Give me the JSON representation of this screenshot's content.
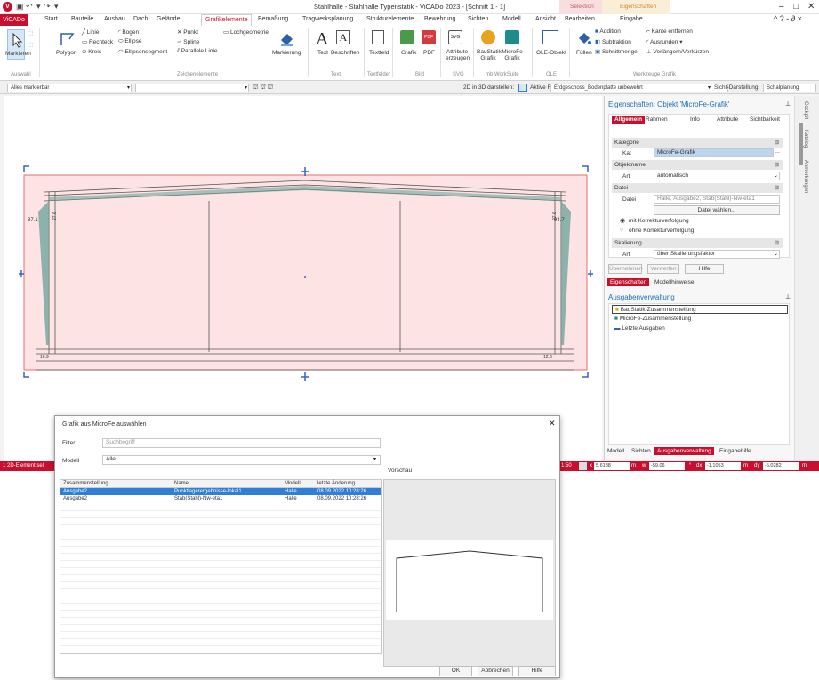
{
  "app": {
    "title": "Stahlhalle - Stahlhalle Typenstatik - ViCADo 2023 - [Schnitt 1 - 1]",
    "context_selection": "Selektion",
    "context_properties": "Eigenschaften",
    "window_controls": [
      "–",
      "□",
      "✕"
    ],
    "ribbon_right_controls": "^ ? - ∂ ×"
  },
  "tabs": [
    "ViCADo",
    "Start",
    "Bauteile",
    "Ausbau",
    "Dach",
    "Gelände",
    "Grafikelemente",
    "Bemaßung",
    "Tragwerksplanung",
    "Strukturelemente",
    "Bewehrung",
    "Sichten",
    "Modell",
    "Ansicht",
    "Bearbeiten",
    "Eingabe"
  ],
  "ribbon": {
    "markieren": "Markieren",
    "auswahl_group": "Auswahl",
    "polygon": "Polygon",
    "linie": "Linie",
    "rechteck": "Rechteck",
    "kreis": "Kreis",
    "bogen": "Bogen",
    "ellipse": "Ellipse",
    "ellipsensegment": "Ellipsensegment",
    "punkt": "Punkt",
    "spline": "Spline",
    "parallele_linie": "Parallele Linie",
    "lochgeometrie": "Lochgeometrie",
    "markierung": "Markierung",
    "zeichenelemente_group": "Zeichenelemente",
    "text": "Text",
    "beschriften": "Beschriften",
    "text_group": "Text",
    "textfeld": "Textfeld",
    "textfelder_group": "Textfelder",
    "grafik": "Grafik",
    "pdf": "PDF",
    "bild_group": "Bild",
    "attribute_erzeugen": "Attribute erzeugen",
    "svg_group": "SVG",
    "baustatik_grafik": "BauStatik Grafik",
    "microfe_grafik": "MicroFe Grafik",
    "workssuite_group": "mb WorkSuite",
    "ole_objekt": "OLE-Objekt",
    "ole_group": "OLE",
    "fuellen": "Füllen",
    "addition": "Addition",
    "subtraktion": "Subtraktion",
    "schnittmenge": "Schnittmenge",
    "kante_entfernen": "Kante entfernen",
    "ausrunden": "Ausrunden",
    "verlaengern": "Verlängern/Verkürzen",
    "werkzeuge_group": "Werkzeuge Grafik"
  },
  "toolbar2": {
    "filter_combo": "Alles markierbar",
    "second_combo": "",
    "show_3d": "2D in 3D darstellen:",
    "active_layer_label": "Aktive Folie:",
    "active_layer": "Erdgeschoss_Bodenplatte unbewehrt",
    "view_display": "Sicht-Darstellung:",
    "view_display_value": "Schalplanung"
  },
  "drawing": {
    "labels": [
      "87.1",
      "94.7",
      "16.9",
      "12.6",
      "27.6",
      "27.6"
    ]
  },
  "properties": {
    "header": "Eigenschaften: Objekt 'MicroFe-Grafik'",
    "tabs": [
      "Allgemein",
      "Rahmen",
      "Info",
      "Attribute",
      "Sichtbarkeit"
    ],
    "section_kategorie": "Kategorie",
    "kat_label": "Kat",
    "kat_value": "MicroFe-Grafik",
    "section_objektname": "Objektname",
    "art_label": "Art",
    "art_value": "automatisch",
    "section_datei": "Datei",
    "datei_label": "Datei",
    "datei_value": "Halle, Ausgabe2, Stab(Stahl)-Nw-eta1",
    "datei_button": "Datei wählen...",
    "radio_mit": "mit Korrekturverfolgung",
    "radio_ohne": "ohne Korrekturverfolgung",
    "section_skalierung": "Skalierung",
    "skal_art_label": "Art",
    "skal_art_value": "über Skalierungsfaktor",
    "btn_uebernehmen": "Übernehmen",
    "btn_verwerfen": "Verwerfen",
    "btn_hilfe": "Hilfe",
    "bottom_tabs": [
      "Eigenschaften",
      "Modellhinweise"
    ]
  },
  "output_manager": {
    "header": "Ausgabenverwaltung",
    "items": [
      "BauStatik-Zusammenstellung",
      "MicroFe-Zusammenstellung",
      "Letzte Ausgaben"
    ],
    "bottom_tabs": [
      "Modell",
      "Sichten",
      "Ausgabenverwaltung",
      "Eingabehilfe"
    ]
  },
  "side_strip": [
    "Cockpit",
    "Katalog",
    "Anmerkungen"
  ],
  "status": {
    "left": "1 2D-Element sel",
    "scale": "1:50",
    "x_label": "x",
    "x": "5.6138",
    "w_label": "w",
    "w": "-59.06",
    "dx_label": "dx",
    "dx": "-1.1053",
    "dy_label": "dy",
    "dy": "-5.0282",
    "unit": "m"
  },
  "dialog": {
    "title": "Grafik aus MicroFe auswählen",
    "close": "✕",
    "filter_label": "Filter:",
    "filter_placeholder": "Suchbegriff",
    "modell_label": "Modell",
    "modell_value": "Alle",
    "preview_label": "Vorschau",
    "columns": [
      "Zusammenstellung",
      "Name",
      "Modell",
      "letzte Änderung"
    ],
    "rows": [
      [
        "Ausgabe2",
        "Punktlagerergebnisse-lokal1",
        "Halle",
        "08.09.2022 10:28:26"
      ],
      [
        "Ausgabe2",
        "Stab(Stahl)-Nw-eta1",
        "Halle",
        "08.09.2022 10:28:26"
      ]
    ],
    "btn_ok": "OK",
    "btn_cancel": "Abbrechen",
    "btn_help": "Hilfe"
  },
  "colors": {
    "brand": "#c8102e",
    "selection": "#2f7ed8",
    "link": "#1f6fb5",
    "drawing_fill": "#fde3e3",
    "drawing_border": "#e07070",
    "handle": "#3a5fcd"
  }
}
